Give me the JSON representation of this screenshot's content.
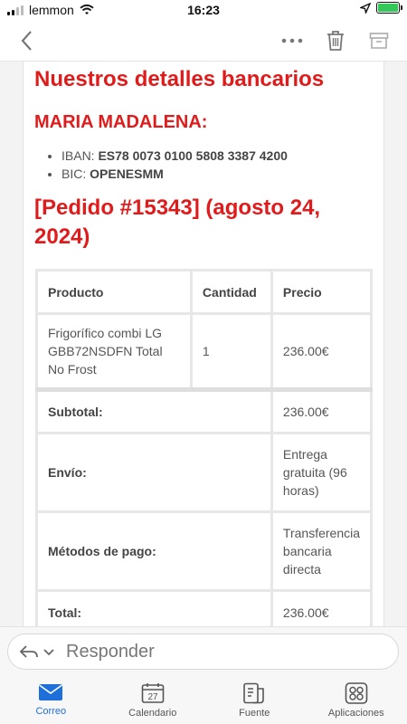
{
  "status_bar": {
    "carrier": "lemmon",
    "time": "16:23"
  },
  "email": {
    "bank_title": "Nuestros detalles bancarios",
    "account_holder": "MARIA MADALENA:",
    "bank_details": [
      {
        "label": "IBAN:",
        "value": "ES78 0073 0100 5808 3387 4200"
      },
      {
        "label": "BIC:",
        "value": "OPENESMM"
      }
    ],
    "order_title": "[Pedido #15343] (agosto 24, 2024)",
    "table": {
      "headers": [
        "Producto",
        "Cantidad",
        "Precio"
      ],
      "item": {
        "product": "Frigorífico combi LG GBB72NSDFN Total No Frost",
        "quantity": "1",
        "price": "236.00€"
      },
      "summary": [
        {
          "label": "Subtotal:",
          "value": "236.00€"
        },
        {
          "label": "Envío:",
          "value": "Entrega gratuita (96 horas)"
        },
        {
          "label": "Métodos de pago:",
          "value": "Transferencia bancaria directa"
        },
        {
          "label": "Total:",
          "value": "236.00€"
        }
      ]
    }
  },
  "reply": {
    "placeholder": "Responder"
  },
  "tabs": [
    {
      "label": "Correo",
      "icon": "mail-icon",
      "active": true
    },
    {
      "label": "Calendario",
      "icon": "calendar-icon",
      "day": "27"
    },
    {
      "label": "Fuente",
      "icon": "feed-icon"
    },
    {
      "label": "Aplicaciones",
      "icon": "apps-icon"
    }
  ],
  "colors": {
    "accent_red": "#e01b1b",
    "active_blue": "#1e6fd9",
    "battery_green": "#34c759"
  }
}
